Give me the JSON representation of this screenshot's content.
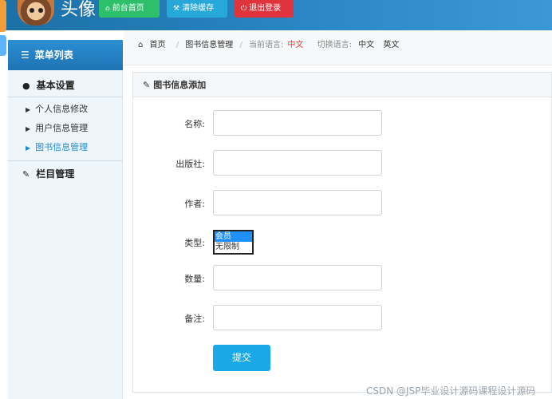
{
  "header": {
    "brand": "头像",
    "buttons": [
      {
        "label": "前台首页",
        "icon": "home-icon"
      },
      {
        "label": "清除缓存",
        "icon": "wrench-icon"
      },
      {
        "label": "退出登录",
        "icon": "power-icon"
      }
    ],
    "colors": {
      "header": "#2a86c4",
      "home": "#2dbf6a",
      "clear": "#26a8d8",
      "logout": "#e0343c"
    }
  },
  "sidebar": {
    "title": "菜单列表",
    "groups": [
      {
        "label": "基本设置",
        "icon": "user-icon",
        "items": [
          {
            "label": "个人信息修改"
          },
          {
            "label": "用户信息管理"
          },
          {
            "label": "图书信息管理",
            "active": true
          }
        ]
      },
      {
        "label": "栏目管理",
        "icon": "edit-icon"
      }
    ]
  },
  "breadcrumb": {
    "home": "首页",
    "current": "图书信息管理",
    "lang_label": "当前语言:",
    "lang_value": "中文",
    "switch_label": "切换语言:",
    "lang_zh": "中文",
    "lang_en": "英文"
  },
  "form": {
    "title": "图书信息添加",
    "fields": {
      "name": {
        "label": "名称:",
        "value": ""
      },
      "publisher": {
        "label": "出版社:",
        "value": ""
      },
      "author": {
        "label": "作者:",
        "value": ""
      },
      "type": {
        "label": "类型:",
        "options": [
          "会员",
          "无限制"
        ],
        "selected": "会员"
      },
      "quantity": {
        "label": "数量:",
        "value": ""
      },
      "remark": {
        "label": "备注:",
        "value": ""
      }
    },
    "submit": "提交"
  },
  "watermark": "CSDN @JSP毕业设计源码课程设计源码"
}
